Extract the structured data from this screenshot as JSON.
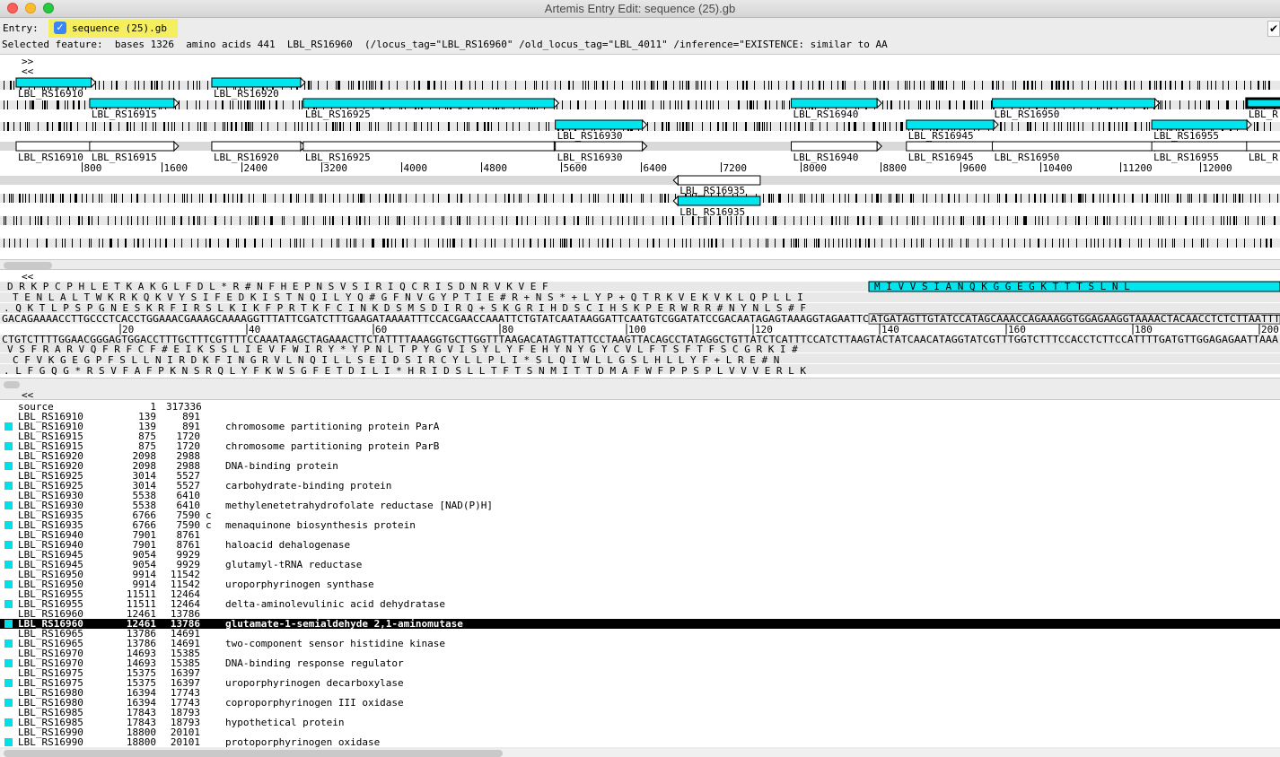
{
  "window": {
    "title": "Artemis Entry Edit: sequence (25).gb"
  },
  "entry_bar": {
    "label": "Entry:",
    "entry_name": "sequence (25).gb",
    "entry_checked": "✓",
    "right_check": "✔"
  },
  "selected_feature": "Selected feature:  bases 1326  amino acids 441  LBL_RS16960  (/locus_tag=\"LBL_RS16960\" /old_locus_tag=\"LBL_4011\" /inference=\"EXISTENCE: similar to AA",
  "overview": {
    "nav_forward": ">>",
    "nav_back": "<<",
    "colors": {
      "cds": "#00e5ee",
      "gene": "#ffffff",
      "gray": "#d9d9d9"
    },
    "forward_cds": [
      {
        "label": "LBL_RS16910",
        "start": 139,
        "end": 891,
        "frame": 1
      },
      {
        "label": "LBL_RS16915",
        "start": 875,
        "end": 1720,
        "frame": 2
      },
      {
        "label": "LBL_RS16920",
        "start": 2098,
        "end": 2988,
        "frame": 1
      },
      {
        "label": "LBL_RS16925",
        "start": 3014,
        "end": 5527,
        "frame": 2
      },
      {
        "label": "LBL_RS16930",
        "start": 5538,
        "end": 6410,
        "frame": 3
      },
      {
        "label": "LBL_RS16940",
        "start": 7901,
        "end": 8761,
        "frame": 2
      },
      {
        "label": "LBL_RS16945",
        "start": 9054,
        "end": 9929,
        "frame": 3
      },
      {
        "label": "LBL_RS16950",
        "start": 9914,
        "end": 11542,
        "frame": 2
      },
      {
        "label": "LBL_RS16955",
        "start": 11511,
        "end": 12464,
        "frame": 3
      },
      {
        "label": "LBL_R",
        "start": 12461,
        "end": 13786,
        "frame": 2
      }
    ],
    "forward_genes": [
      {
        "label": "LBL_RS16910",
        "start": 139,
        "end": 891
      },
      {
        "label": "LBL_RS16915",
        "start": 875,
        "end": 1720
      },
      {
        "label": "LBL_RS16920",
        "start": 2098,
        "end": 2988
      },
      {
        "label": "LBL_RS16925",
        "start": 3014,
        "end": 5527
      },
      {
        "label": "LBL_RS16930",
        "start": 5538,
        "end": 6410
      },
      {
        "label": "LBL_RS16940",
        "start": 7901,
        "end": 8761
      },
      {
        "label": "LBL_RS16945",
        "start": 9054,
        "end": 9929
      },
      {
        "label": "LBL_RS16950",
        "start": 9914,
        "end": 11542
      },
      {
        "label": "LBL_RS16955",
        "start": 11511,
        "end": 12464
      },
      {
        "label": "LBL_R",
        "start": 12461,
        "end": 13786
      }
    ],
    "ruler_ticks": [
      "800",
      "1600",
      "2400",
      "3200",
      "4000",
      "4800",
      "5600",
      "6400",
      "7200",
      "8000",
      "8800",
      "9600",
      "10400",
      "11200",
      "12000"
    ],
    "reverse_gene": {
      "label": "LBL_RS16935",
      "start": 6766,
      "end": 7590
    },
    "reverse_cds": {
      "label": "LBL_RS16935",
      "start": 6766,
      "end": 7590
    }
  },
  "sequence_view": {
    "nav_back": "<<",
    "frame1": "D R K P C P H L E T K A K G L F D L * R # N F H E P N S V S I R I Q C R I S D N R V K V E F",
    "frame1_sel": "M I V V S I A N Q K G G E G K T T T S L N L",
    "frame2": "T E N L A L T W K R K Q K V Y S I F E D K I S T N Q I L Y Q # G F N V G Y P T I E # R + N S * + L Y P + Q T R K V E K V K L Q P L L I",
    "frame3": ". Q K T L P S P G N E S K R F I R S L K I K F P R T K F C I N K D S M S D I R Q + S K G R I H D S C I H S K P E R W R R # N Y N L S # F",
    "forward_dna_a": "GACAGAAAACCTTGCCCTCACCTGGAAACGAAAGCAAAAGGTTTATTCGATCTTTGAAGATAAAATTTCCACGAACCAAATTCTGTATCAATAAGGATTCAATGTCGGATATCCGACAATAGAGTAAAGGTAGAATTC",
    "forward_dna_b": "ATGATAGTTGTATCCATAGCAAACCAGAAAGGTGGAGAAGGTAAAACTACAACCTCTCTTAATTT",
    "ruler": [
      "20",
      "40",
      "60",
      "80",
      "100",
      "120",
      "140",
      "160",
      "180",
      "200"
    ],
    "reverse_dna": "CTGTCTTTTGGAACGGGAGTGGACCTTTGCTTTCGTTTTCCAAATAAGCTAGAAACTTCTATTTTAAAGGTGCTTGGTTTAAGACATAGTTATTCCTAAGTTACAGCCTATAGGCTGTTATCTCATTTCCATCTTAAGTACTATCAACATAGGTATCGTTTGGTCTTTCCACCTCTTCCATTTTGATGTTGGAGAGAATTAAA",
    "rframe1": "V S F R A R V Q F R F C F # E I K S S L I E V F W I R Y * Y P N L T P Y G V I S Y L Y F E H Y N Y G Y C V L F T S F T F S C G R K I #",
    "rframe2": "C F V K G E G P F S L L N I R D K F I N G R V L N Q I L L S E I D S I R C Y L L P L I * S L Q I W L L G S L H L L Y F + L R E # N",
    "rframe3": ". L F G Q G * R S V F A F P K N S R Q L Y F K W S G F E T D I L I * H R I D S L L T F T S N M I T T D M A F W F P P S P L V V V E R L K"
  },
  "feature_list": {
    "nav_back": "<<",
    "rows": [
      {
        "name": "source",
        "start": "1",
        "end": "317336",
        "strand": "",
        "product": "",
        "cds": false,
        "selected": false
      },
      {
        "name": "LBL_RS16910",
        "start": "139",
        "end": "891",
        "strand": "",
        "product": "",
        "cds": false,
        "selected": false
      },
      {
        "name": "LBL_RS16910",
        "start": "139",
        "end": "891",
        "strand": "",
        "product": "chromosome partitioning protein ParA",
        "cds": true,
        "selected": false
      },
      {
        "name": "LBL_RS16915",
        "start": "875",
        "end": "1720",
        "strand": "",
        "product": "",
        "cds": false,
        "selected": false
      },
      {
        "name": "LBL_RS16915",
        "start": "875",
        "end": "1720",
        "strand": "",
        "product": "chromosome partitioning protein ParB",
        "cds": true,
        "selected": false
      },
      {
        "name": "LBL_RS16920",
        "start": "2098",
        "end": "2988",
        "strand": "",
        "product": "",
        "cds": false,
        "selected": false
      },
      {
        "name": "LBL_RS16920",
        "start": "2098",
        "end": "2988",
        "strand": "",
        "product": "DNA-binding protein",
        "cds": true,
        "selected": false
      },
      {
        "name": "LBL_RS16925",
        "start": "3014",
        "end": "5527",
        "strand": "",
        "product": "",
        "cds": false,
        "selected": false
      },
      {
        "name": "LBL_RS16925",
        "start": "3014",
        "end": "5527",
        "strand": "",
        "product": "carbohydrate-binding protein",
        "cds": true,
        "selected": false
      },
      {
        "name": "LBL_RS16930",
        "start": "5538",
        "end": "6410",
        "strand": "",
        "product": "",
        "cds": false,
        "selected": false
      },
      {
        "name": "LBL_RS16930",
        "start": "5538",
        "end": "6410",
        "strand": "",
        "product": "methylenetetrahydrofolate reductase [NAD(P)H]",
        "cds": true,
        "selected": false
      },
      {
        "name": "LBL_RS16935",
        "start": "6766",
        "end": "7590",
        "strand": "c",
        "product": "",
        "cds": false,
        "selected": false
      },
      {
        "name": "LBL_RS16935",
        "start": "6766",
        "end": "7590",
        "strand": "c",
        "product": "menaquinone biosynthesis protein",
        "cds": true,
        "selected": false
      },
      {
        "name": "LBL_RS16940",
        "start": "7901",
        "end": "8761",
        "strand": "",
        "product": "",
        "cds": false,
        "selected": false
      },
      {
        "name": "LBL_RS16940",
        "start": "7901",
        "end": "8761",
        "strand": "",
        "product": "haloacid dehalogenase",
        "cds": true,
        "selected": false
      },
      {
        "name": "LBL_RS16945",
        "start": "9054",
        "end": "9929",
        "strand": "",
        "product": "",
        "cds": false,
        "selected": false
      },
      {
        "name": "LBL_RS16945",
        "start": "9054",
        "end": "9929",
        "strand": "",
        "product": "glutamyl-tRNA reductase",
        "cds": true,
        "selected": false
      },
      {
        "name": "LBL_RS16950",
        "start": "9914",
        "end": "11542",
        "strand": "",
        "product": "",
        "cds": false,
        "selected": false
      },
      {
        "name": "LBL_RS16950",
        "start": "9914",
        "end": "11542",
        "strand": "",
        "product": "uroporphyrinogen synthase",
        "cds": true,
        "selected": false
      },
      {
        "name": "LBL_RS16955",
        "start": "11511",
        "end": "12464",
        "strand": "",
        "product": "",
        "cds": false,
        "selected": false
      },
      {
        "name": "LBL_RS16955",
        "start": "11511",
        "end": "12464",
        "strand": "",
        "product": "delta-aminolevulinic acid dehydratase",
        "cds": true,
        "selected": false
      },
      {
        "name": "LBL_RS16960",
        "start": "12461",
        "end": "13786",
        "strand": "",
        "product": "",
        "cds": false,
        "selected": false
      },
      {
        "name": "LBL_RS16960",
        "start": "12461",
        "end": "13786",
        "strand": "",
        "product": "glutamate-1-semialdehyde 2,1-aminomutase",
        "cds": true,
        "selected": true
      },
      {
        "name": "LBL_RS16965",
        "start": "13786",
        "end": "14691",
        "strand": "",
        "product": "",
        "cds": false,
        "selected": false
      },
      {
        "name": "LBL_RS16965",
        "start": "13786",
        "end": "14691",
        "strand": "",
        "product": "two-component sensor histidine kinase",
        "cds": true,
        "selected": false
      },
      {
        "name": "LBL_RS16970",
        "start": "14693",
        "end": "15385",
        "strand": "",
        "product": "",
        "cds": false,
        "selected": false
      },
      {
        "name": "LBL_RS16970",
        "start": "14693",
        "end": "15385",
        "strand": "",
        "product": "DNA-binding response regulator",
        "cds": true,
        "selected": false
      },
      {
        "name": "LBL_RS16975",
        "start": "15375",
        "end": "16397",
        "strand": "",
        "product": "",
        "cds": false,
        "selected": false
      },
      {
        "name": "LBL_RS16975",
        "start": "15375",
        "end": "16397",
        "strand": "",
        "product": "uroporphyrinogen decarboxylase",
        "cds": true,
        "selected": false
      },
      {
        "name": "LBL_RS16980",
        "start": "16394",
        "end": "17743",
        "strand": "",
        "product": "",
        "cds": false,
        "selected": false
      },
      {
        "name": "LBL_RS16980",
        "start": "16394",
        "end": "17743",
        "strand": "",
        "product": "coproporphyrinogen III oxidase",
        "cds": true,
        "selected": false
      },
      {
        "name": "LBL_RS16985",
        "start": "17843",
        "end": "18793",
        "strand": "",
        "product": "",
        "cds": false,
        "selected": false
      },
      {
        "name": "LBL_RS16985",
        "start": "17843",
        "end": "18793",
        "strand": "",
        "product": "hypothetical protein",
        "cds": true,
        "selected": false
      },
      {
        "name": "LBL_RS16990",
        "start": "18800",
        "end": "20101",
        "strand": "",
        "product": "",
        "cds": false,
        "selected": false
      },
      {
        "name": "LBL_RS16990",
        "start": "18800",
        "end": "20101",
        "strand": "",
        "product": "protoporphyrinogen oxidase",
        "cds": true,
        "selected": false
      }
    ]
  }
}
